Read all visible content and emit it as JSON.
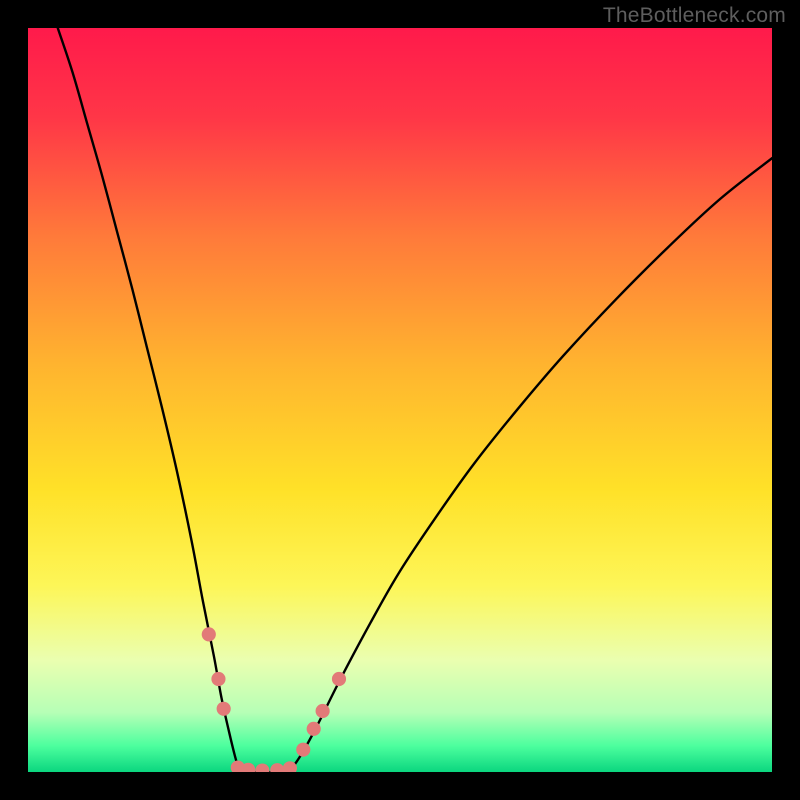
{
  "watermark": "TheBottleneck.com",
  "chart_data": {
    "type": "line",
    "title": "",
    "xlabel": "",
    "ylabel": "",
    "xlim": [
      0,
      100
    ],
    "ylim": [
      0,
      100
    ],
    "background_gradient": [
      {
        "stop": 0.0,
        "color": "#ff1a4b"
      },
      {
        "stop": 0.12,
        "color": "#ff3647"
      },
      {
        "stop": 0.28,
        "color": "#ff7a3a"
      },
      {
        "stop": 0.45,
        "color": "#ffb32f"
      },
      {
        "stop": 0.62,
        "color": "#ffe128"
      },
      {
        "stop": 0.75,
        "color": "#fdf658"
      },
      {
        "stop": 0.85,
        "color": "#eaffb0"
      },
      {
        "stop": 0.92,
        "color": "#b6ffb6"
      },
      {
        "stop": 0.965,
        "color": "#4cff9e"
      },
      {
        "stop": 1.0,
        "color": "#0bd67f"
      }
    ],
    "series": [
      {
        "name": "left-curve",
        "note": "descending branch; y is curve height (0=bottom,100=top)",
        "x": [
          4,
          6,
          8,
          10,
          12,
          14,
          16,
          18,
          20,
          22,
          23.5,
          25,
          26,
          27,
          27.8,
          28.3
        ],
        "y": [
          100,
          94,
          87,
          80,
          72.5,
          65,
          57,
          49,
          40.5,
          31,
          23,
          15.5,
          10,
          5.5,
          2.2,
          0.5
        ]
      },
      {
        "name": "trough",
        "x": [
          28.3,
          30,
          32,
          34,
          35.5
        ],
        "y": [
          0.5,
          0,
          0,
          0,
          0.5
        ]
      },
      {
        "name": "right-curve",
        "x": [
          35.5,
          37,
          39,
          42,
          46,
          50,
          55,
          60,
          66,
          72,
          79,
          86,
          93,
          100
        ],
        "y": [
          0.5,
          2.8,
          6.5,
          12.5,
          20,
          27,
          34.5,
          41.5,
          49,
          56,
          63.5,
          70.5,
          77,
          82.5
        ]
      }
    ],
    "markers": {
      "name": "trough-dots",
      "color": "#e27a78",
      "radius_pct": 0.95,
      "points": [
        {
          "x": 24.3,
          "y": 18.5
        },
        {
          "x": 25.6,
          "y": 12.5
        },
        {
          "x": 26.3,
          "y": 8.5
        },
        {
          "x": 28.2,
          "y": 0.6
        },
        {
          "x": 29.6,
          "y": 0.3
        },
        {
          "x": 31.5,
          "y": 0.2
        },
        {
          "x": 33.5,
          "y": 0.25
        },
        {
          "x": 35.2,
          "y": 0.5
        },
        {
          "x": 37.0,
          "y": 3.0
        },
        {
          "x": 38.4,
          "y": 5.8
        },
        {
          "x": 39.6,
          "y": 8.2
        },
        {
          "x": 41.8,
          "y": 12.5
        }
      ]
    }
  }
}
